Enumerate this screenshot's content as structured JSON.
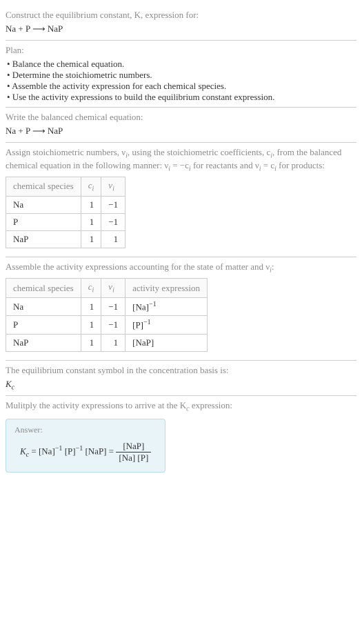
{
  "header": {
    "construct": "Construct the equilibrium constant, K, expression for:",
    "equation_in": "Na + P ⟶ NaP"
  },
  "plan": {
    "title": "Plan:",
    "b1": "• Balance the chemical equation.",
    "b2": "• Determine the stoichiometric numbers.",
    "b3": "• Assemble the activity expression for each chemical species.",
    "b4": "• Use the activity expressions to build the equilibrium constant expression."
  },
  "balanced": {
    "title": "Write the balanced chemical equation:",
    "eq": "Na + P ⟶ NaP"
  },
  "stoich": {
    "desc1": "Assign stoichiometric numbers, ν",
    "desc1b": ", using the stoichiometric coefficients, c",
    "desc1c": ", from the balanced chemical equation in the following manner: ν",
    "desc1d": " = −c",
    "desc1e": " for reactants and ν",
    "desc1f": " = c",
    "desc1g": " for products:",
    "th1": "chemical species",
    "th2": "c",
    "th3": "ν",
    "r1c1": "Na",
    "r1c2": "1",
    "r1c3": "−1",
    "r2c1": "P",
    "r2c2": "1",
    "r2c3": "−1",
    "r3c1": "NaP",
    "r3c2": "1",
    "r3c3": "1"
  },
  "activity": {
    "desc": "Assemble the activity expressions accounting for the state of matter and ν",
    "desc2": ":",
    "th1": "chemical species",
    "th2": "c",
    "th3": "ν",
    "th4": "activity expression",
    "r1c1": "Na",
    "r1c2": "1",
    "r1c3": "−1",
    "r1c4a": "[Na]",
    "r1c4s": "−1",
    "r2c1": "P",
    "r2c2": "1",
    "r2c3": "−1",
    "r2c4a": "[P]",
    "r2c4s": "−1",
    "r3c1": "NaP",
    "r3c2": "1",
    "r3c3": "1",
    "r3c4": "[NaP]"
  },
  "symbol": {
    "desc": "The equilibrium constant symbol in the concentration basis is:",
    "sym": "K",
    "sub": "c"
  },
  "multiply": {
    "desc1": "Mulitply the activity expressions to arrive at the K",
    "desc2": " expression:"
  },
  "answer": {
    "label": "Answer:",
    "lhs_K": "K",
    "lhs_sub": "c",
    "eq": " = ",
    "t1": "[Na]",
    "s1": "−1",
    "t2": "[P]",
    "s2": "−1",
    "t3": "[NaP]",
    "eq2": " = ",
    "frac_num": "[NaP]",
    "frac_den": "[Na] [P]"
  }
}
